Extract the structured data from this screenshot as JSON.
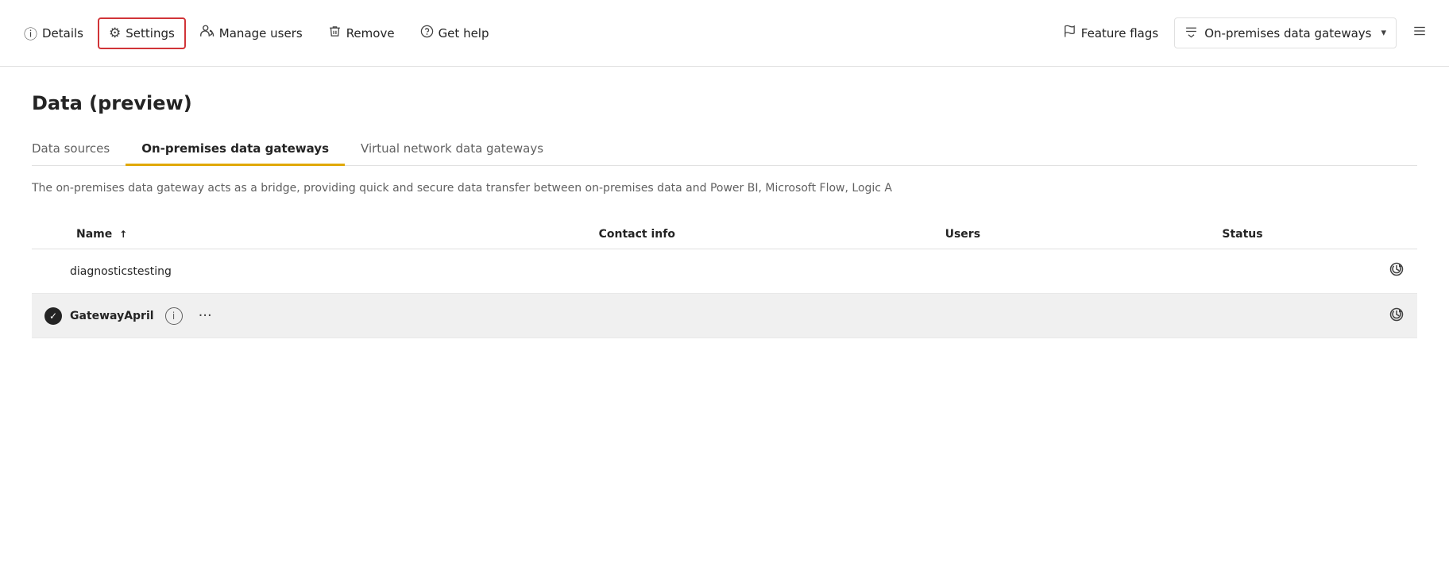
{
  "toolbar": {
    "items": [
      {
        "id": "details",
        "label": "Details",
        "icon": "ⓘ",
        "active": false
      },
      {
        "id": "settings",
        "label": "Settings",
        "icon": "⚙",
        "active": true
      },
      {
        "id": "manage-users",
        "label": "Manage users",
        "icon": "👥",
        "active": false
      },
      {
        "id": "remove",
        "label": "Remove",
        "icon": "🗑",
        "active": false
      },
      {
        "id": "get-help",
        "label": "Get help",
        "icon": "?",
        "active": false
      }
    ],
    "right_items": [
      {
        "id": "feature-flags",
        "label": "Feature flags",
        "icon": "⚑"
      },
      {
        "id": "on-premises",
        "label": "On-premises data gateways",
        "icon": "≡▽"
      }
    ],
    "more_icon": "≡"
  },
  "page": {
    "title": "Data (preview)"
  },
  "tabs": [
    {
      "id": "data-sources",
      "label": "Data sources",
      "active": false
    },
    {
      "id": "on-premises-gateways",
      "label": "On-premises data gateways",
      "active": true
    },
    {
      "id": "virtual-network-gateways",
      "label": "Virtual network data gateways",
      "active": false
    }
  ],
  "description": "The on-premises data gateway acts as a bridge, providing quick and secure data transfer between on-premises data and Power BI, Microsoft Flow, Logic A",
  "table": {
    "columns": [
      {
        "id": "name",
        "label": "Name",
        "sort": "↑"
      },
      {
        "id": "contact",
        "label": "Contact info"
      },
      {
        "id": "users",
        "label": "Users"
      },
      {
        "id": "status",
        "label": "Status"
      }
    ],
    "rows": [
      {
        "id": "row1",
        "selected": false,
        "checked": false,
        "name": "diagnosticstesting",
        "name_bold": false,
        "contact": "",
        "users": "",
        "status_icon": "↻",
        "has_info": false,
        "has_ellipsis": false
      },
      {
        "id": "row2",
        "selected": true,
        "checked": true,
        "name": "GatewayApril",
        "name_bold": true,
        "contact": "",
        "users": "",
        "status_icon": "↻",
        "has_info": true,
        "has_ellipsis": true
      }
    ]
  }
}
